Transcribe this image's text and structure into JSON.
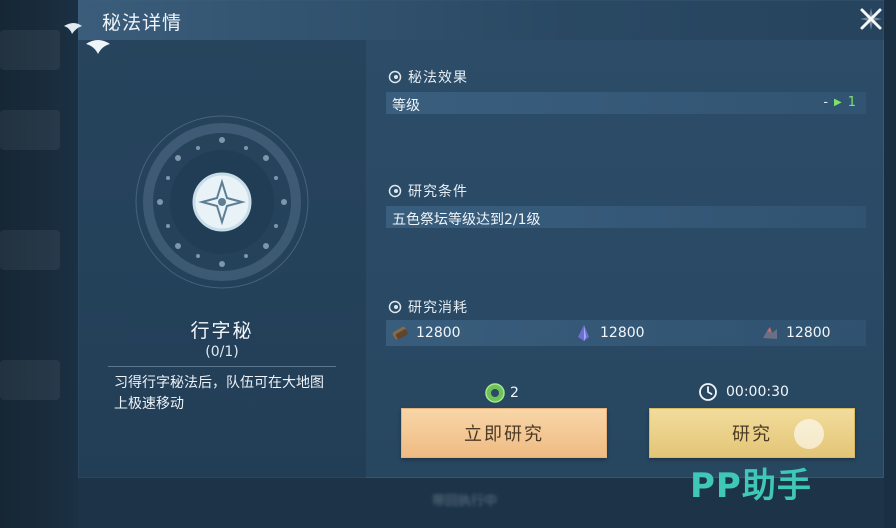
{
  "window": {
    "title": "秘法详情"
  },
  "skill": {
    "name": "行字秘",
    "level": "(0/1)",
    "description": "习得行字秘法后，队伍可在大地图上极速移动"
  },
  "effect": {
    "heading": "秘法效果",
    "label": "等级",
    "from": "-",
    "to": "1"
  },
  "condition": {
    "heading": "研究条件",
    "text": "五色祭坛等级达到2/1级"
  },
  "cost": {
    "heading": "研究消耗",
    "items": [
      {
        "icon": "wood-resource-icon",
        "amount": "12800"
      },
      {
        "icon": "crystal-resource-icon",
        "amount": "12800"
      },
      {
        "icon": "ore-resource-icon",
        "amount": "12800"
      }
    ]
  },
  "instant": {
    "jade_count": "2",
    "button_label": "立即研究"
  },
  "research": {
    "time": "00:00:30",
    "button_label": "研究"
  },
  "bottom": {
    "hint": "带回执行中"
  },
  "watermark": {
    "text": "PP助手"
  },
  "colors": {
    "accent_green": "#7fe26c",
    "button_orange": "#efbb83",
    "button_gold": "#e3c576",
    "watermark": "#3fc7b8"
  }
}
